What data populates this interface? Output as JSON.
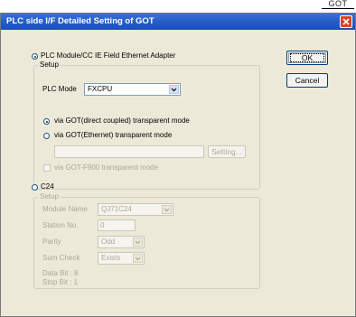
{
  "doc_tag": "GOT",
  "window": {
    "title": "PLC side I/F Detailed Setting of GOT"
  },
  "buttons": {
    "ok": "OK",
    "cancel": "Cancel"
  },
  "plc_module_radio": "PLC Module/CC IE Field Ethernet Adapter",
  "setup": {
    "legend": "Setup",
    "plc_mode_label": "PLC Mode",
    "plc_mode_value": "FXCPU",
    "direct_coupled_option": "via GOT(direct coupled) transparent mode",
    "ethernet_option": "via GOT(Ethernet) transparent mode",
    "ethernet_address_value": "",
    "setting_button": "Setting...",
    "f900_checkbox": "via GOT-F900 transparent mode"
  },
  "c24": {
    "radio": "C24",
    "legend": "Setup",
    "module_name_label": "Module Name",
    "module_name_value": "QJ71C24",
    "station_no_label": "Station No.",
    "station_no_value": "0",
    "parity_label": "Parity",
    "parity_value": "Odd",
    "sum_check_label": "Sum Check",
    "sum_check_value": "Exists",
    "data_bit": "Data Bit : 8",
    "stop_bit": "Stop Bit : 1"
  },
  "icons": {
    "close": "close-icon",
    "dropdown": "chevron-down-icon"
  },
  "colors": {
    "titlebar": "#245ec7",
    "close_button": "#d9441f",
    "dialog_bg": "#ece9d8",
    "disabled_text": "#aca899"
  }
}
